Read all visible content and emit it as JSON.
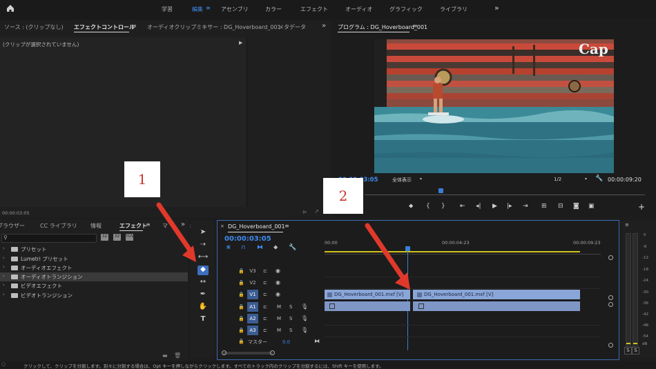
{
  "workspaces": [
    "学習",
    "編集",
    "アセンブリ",
    "カラー",
    "エフェクト",
    "オーディオ",
    "グラフィック",
    "ライブラリ"
  ],
  "active_workspace": "編集",
  "more_workspaces": "»",
  "source_panel": {
    "tabs": [
      "ソース : (クリップなし)",
      "エフェクトコントロール",
      "オーディオクリップミキサー : DG_Hoverboard_001",
      "メタデータ"
    ],
    "active_tab": "エフェクトコントロール",
    "empty_message": "(クリップが選択されていません)",
    "timecode": "00:00:03:05"
  },
  "program_monitor": {
    "title": "プログラム : DG_Hoverboard_001",
    "timecode_left": "00:00:03:05",
    "fit": "全体表示",
    "resolution": "1/2",
    "timecode_right": "00:00:09:20",
    "video_overlay_text": "Cap"
  },
  "effects_panel": {
    "tabs": [
      "ブラウザー",
      "CC ライブラリ",
      "情報",
      "エフェクト",
      "マ"
    ],
    "active_tab": "エフェクト",
    "search_placeholder": "",
    "items": [
      "プリセット",
      "Lumetri プリセット",
      "オーディオエフェクト",
      "オーディオトランジション",
      "ビデオエフェクト",
      "ビデオトランジション"
    ],
    "selected_item": "オーディオトランジション"
  },
  "timeline": {
    "sequence_name": "DG_Hoverboard_001",
    "timecode": "00:00:03:05",
    "ruler": [
      "00:00",
      "00:00:04:23",
      "00:00:09:23"
    ],
    "video_tracks": [
      "V3",
      "V2",
      "V1"
    ],
    "audio_tracks": [
      "A1",
      "A2",
      "A3"
    ],
    "master_label": "マスター",
    "master_value": "0.0",
    "audio_btn_m": "M",
    "audio_btn_s": "S",
    "clip_name": "DG_Hoverboard_001.mxf [V]"
  },
  "meter": {
    "scale": [
      "0",
      "-6",
      "-12",
      "-18",
      "-24",
      "-30",
      "-36",
      "-42",
      "-48",
      "-54",
      "dB"
    ],
    "buttons": [
      "S",
      "S"
    ]
  },
  "status_bar": "クリックして、クリップを分割します。別々に分割する場合は、Opt キーを押しながらクリックします。すべてのトラック内のクリップを分割するには、Shift キーを使用します。",
  "callouts": [
    "1",
    "2"
  ],
  "colors": {
    "accent": "#3f8bf0",
    "clip": "#8aa6d8",
    "playhead": "#3b7ed6",
    "arrow": "#e0392b"
  }
}
